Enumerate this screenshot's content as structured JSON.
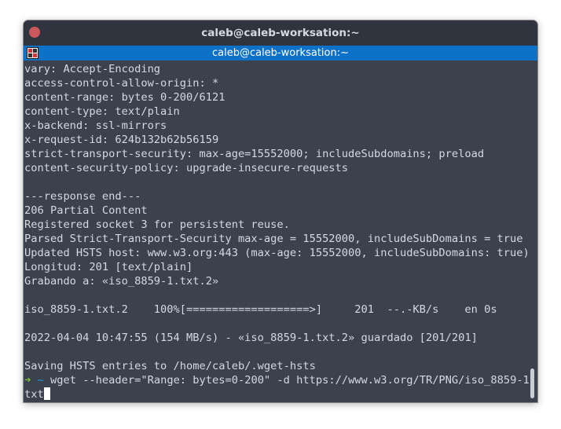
{
  "window": {
    "title": "caleb@caleb-worksation:~",
    "tab_title": "caleb@caleb-worksation:~"
  },
  "terminal": {
    "lines": [
      "vary: Accept-Encoding",
      "access-control-allow-origin: *",
      "content-range: bytes 0-200/6121",
      "content-type: text/plain",
      "x-backend: ssl-mirrors",
      "x-request-id: 624b132b62b56159",
      "strict-transport-security: max-age=15552000; includeSubdomains; preload",
      "content-security-policy: upgrade-insecure-requests",
      "",
      "---response end---",
      "206 Partial Content",
      "Registered socket 3 for persistent reuse.",
      "Parsed Strict-Transport-Security max-age = 15552000, includeSubDomains = true",
      "Updated HSTS host: www.w3.org:443 (max-age: 15552000, includeSubDomains: true)",
      "Longitud: 201 [text/plain]",
      "Grabando a: «iso_8859-1.txt.2»",
      "",
      "iso_8859-1.txt.2    100%[===================>]     201  --.-KB/s    en 0s",
      "",
      "2022-04-04 10:47:55 (154 MB/s) - «iso_8859-1.txt.2» guardado [201/201]",
      "",
      "Saving HSTS entries to /home/caleb/.wget-hsts"
    ],
    "prompt_arrow": "➜",
    "prompt_dir": "~",
    "command": "wget --header=\"Range: bytes=0-200\" -d https://www.w3.org/TR/PNG/iso_8859-1.",
    "command_wrap": "txt"
  },
  "colors": {
    "background": "#3b414d",
    "titlebar": "#2f343f",
    "tabbar": "#0e71c8",
    "text": "#d3dae3",
    "prompt_arrow": "#7fbf3f",
    "prompt_dir": "#1e9bd9",
    "close_button": "#cc575d"
  },
  "icons": {
    "close": "close-icon",
    "tab": "terminal-tab-icon"
  }
}
